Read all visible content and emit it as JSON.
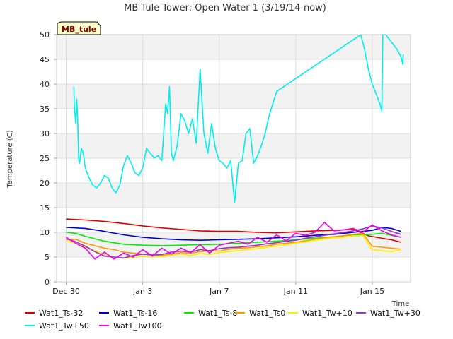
{
  "chart_data": {
    "type": "line",
    "title": "MB Tule Tower: Open Water 1 (3/19/14-now)",
    "xlabel": "Time",
    "ylabel": "Temperature (C)",
    "badge": "MB_tule",
    "ylim": [
      0,
      50
    ],
    "yticks": [
      0,
      5,
      10,
      15,
      20,
      25,
      30,
      35,
      40,
      45,
      50
    ],
    "xlim": [
      -0.5,
      18
    ],
    "xticks": [
      {
        "value": 0,
        "label": "Dec 30"
      },
      {
        "value": 4,
        "label": "Jan 3"
      },
      {
        "value": 8,
        "label": "Jan 7"
      },
      {
        "value": 12,
        "label": "Jan 11"
      },
      {
        "value": 16,
        "label": "Jan 15"
      }
    ],
    "grid": true,
    "legend_position": "bottom",
    "series": [
      {
        "name": "Wat1_Ts-32",
        "color": "#dd0000",
        "x": [
          0.0,
          1.0,
          2.0,
          3.0,
          4.0,
          5.0,
          6.0,
          7.0,
          8.0,
          9.0,
          10.0,
          11.0,
          12.0,
          13.0,
          14.0,
          15.0,
          15.8,
          16.5,
          17.0,
          17.5
        ],
        "values": [
          12.7,
          12.5,
          12.2,
          11.8,
          11.3,
          10.9,
          10.6,
          10.3,
          10.2,
          10.2,
          10.0,
          9.9,
          10.1,
          10.3,
          10.4,
          10.6,
          9.3,
          8.8,
          8.5,
          8.0
        ]
      },
      {
        "name": "Wat1_Ts-16",
        "color": "#0000cc",
        "x": [
          0.0,
          1.0,
          2.0,
          3.0,
          4.0,
          5.0,
          6.0,
          7.0,
          8.0,
          9.0,
          10.0,
          11.0,
          12.0,
          13.0,
          14.0,
          15.0,
          16.0,
          16.5,
          17.0,
          17.5
        ],
        "values": [
          11.0,
          10.8,
          10.2,
          9.5,
          9.0,
          8.7,
          8.5,
          8.4,
          8.5,
          8.6,
          8.7,
          8.9,
          9.1,
          9.4,
          9.6,
          10.0,
          10.4,
          11.0,
          10.8,
          10.2
        ]
      },
      {
        "name": "Wat1_Ts-8",
        "color": "#00ee00",
        "x": [
          0.0,
          0.5,
          1.0,
          2.0,
          3.0,
          4.0,
          5.0,
          6.0,
          7.0,
          8.0,
          9.0,
          10.0,
          11.0,
          12.0,
          13.0,
          14.0,
          15.0,
          16.0,
          16.5,
          17.0,
          17.5
        ],
        "values": [
          10.0,
          9.8,
          9.2,
          8.2,
          7.6,
          7.4,
          7.3,
          7.4,
          7.5,
          7.6,
          7.8,
          8.0,
          8.2,
          8.5,
          8.8,
          9.1,
          9.5,
          9.6,
          9.8,
          9.4,
          9.0
        ]
      },
      {
        "name": "Wat1_Ts0",
        "color": "#ff9900",
        "x": [
          0.0,
          0.5,
          1.0,
          1.5,
          2.0,
          2.5,
          3.0,
          3.5,
          4.0,
          4.5,
          5.0,
          5.5,
          6.0,
          6.5,
          7.0,
          7.5,
          8.0,
          8.5,
          9.0,
          9.5,
          10.0,
          10.5,
          11.0,
          11.5,
          12.0,
          12.5,
          13.0,
          13.5,
          14.0,
          14.5,
          15.0,
          15.5,
          16.0,
          16.5,
          17.0,
          17.5
        ],
        "values": [
          8.5,
          8.6,
          7.8,
          7.3,
          6.8,
          6.5,
          6.0,
          5.8,
          5.6,
          5.5,
          5.3,
          5.6,
          5.9,
          5.8,
          6.1,
          6.3,
          6.2,
          6.6,
          6.8,
          6.9,
          7.1,
          7.3,
          7.6,
          7.8,
          8.0,
          8.3,
          8.6,
          8.9,
          9.1,
          9.3,
          9.6,
          9.8,
          7.2,
          7.0,
          6.8,
          6.6
        ]
      },
      {
        "name": "Wat1_Tw+10",
        "color": "#ffee00",
        "x": [
          0.0,
          0.5,
          1.0,
          1.5,
          2.0,
          2.5,
          3.0,
          3.5,
          4.0,
          4.5,
          5.0,
          5.5,
          6.0,
          6.5,
          7.0,
          7.5,
          8.0,
          8.5,
          9.0,
          9.5,
          10.0,
          10.5,
          11.0,
          11.5,
          12.0,
          12.5,
          13.0,
          13.5,
          14.0,
          14.5,
          15.0,
          15.5,
          16.0,
          16.5,
          17.0,
          17.5
        ],
        "values": [
          8.2,
          7.9,
          7.0,
          6.3,
          5.6,
          5.0,
          4.8,
          4.9,
          5.2,
          5.0,
          5.1,
          5.4,
          5.6,
          5.3,
          5.7,
          5.5,
          5.9,
          6.1,
          6.3,
          6.5,
          6.7,
          7.0,
          7.2,
          7.5,
          7.8,
          8.1,
          8.4,
          8.7,
          8.9,
          9.0,
          9.2,
          9.4,
          6.5,
          6.3,
          6.1,
          6.5
        ]
      },
      {
        "name": "Wat1_Tw+30",
        "color": "#9933cc",
        "x": [
          0.0,
          0.5,
          1.0,
          1.5,
          2.0,
          2.5,
          3.0,
          3.5,
          4.0,
          4.5,
          5.0,
          5.5,
          6.0,
          6.5,
          7.0,
          7.5,
          8.0,
          8.5,
          9.0,
          9.5,
          10.0,
          10.5,
          11.0,
          11.5,
          12.0,
          12.5,
          13.0,
          13.5,
          14.0,
          14.5,
          15.0,
          15.5,
          16.0,
          16.5,
          17.0,
          17.5
        ],
        "values": [
          8.7,
          8.1,
          7.2,
          6.1,
          5.2,
          5.0,
          4.8,
          5.3,
          5.6,
          5.4,
          5.5,
          6.0,
          6.2,
          6.0,
          6.5,
          6.3,
          6.7,
          6.9,
          7.0,
          7.2,
          7.4,
          7.7,
          7.9,
          8.2,
          8.4,
          8.8,
          9.1,
          9.4,
          9.7,
          10.0,
          10.3,
          10.7,
          11.3,
          10.9,
          10.2,
          9.6
        ]
      },
      {
        "name": "Wat1_Tw+50",
        "color": "#00eeee",
        "x": [
          0.4,
          0.42,
          0.5,
          0.55,
          0.6,
          0.65,
          0.7,
          0.8,
          0.9,
          1.0,
          1.1,
          1.2,
          1.4,
          1.6,
          1.8,
          2.0,
          2.2,
          2.4,
          2.6,
          2.8,
          3.0,
          3.2,
          3.4,
          3.6,
          3.8,
          4.0,
          4.2,
          4.4,
          4.6,
          4.8,
          5.0,
          5.2,
          5.3,
          5.4,
          5.5,
          5.6,
          5.8,
          6.0,
          6.2,
          6.4,
          6.6,
          6.8,
          7.0,
          7.2,
          7.4,
          7.6,
          7.8,
          8.0,
          8.2,
          8.4,
          8.6,
          8.8,
          9.0,
          9.2,
          9.4,
          9.6,
          9.8,
          10.0,
          10.2,
          10.4,
          10.6,
          10.8,
          11.0,
          15.4,
          15.6,
          15.8,
          16.0,
          16.2,
          16.4,
          16.5,
          16.55,
          16.7,
          16.9,
          17.1,
          17.3,
          17.5,
          17.6,
          17.62
        ],
        "values": [
          39.5,
          36.0,
          32.0,
          37.0,
          33.0,
          25.0,
          24.0,
          27.0,
          26.0,
          23.0,
          22.0,
          21.0,
          19.5,
          19.0,
          20.0,
          21.5,
          21.0,
          19.0,
          18.0,
          19.5,
          23.5,
          25.5,
          24.0,
          22.0,
          21.5,
          23.0,
          27.0,
          26.0,
          25.0,
          25.5,
          24.5,
          36.0,
          34.0,
          39.5,
          26.0,
          24.5,
          27.5,
          34.0,
          32.5,
          30.0,
          33.0,
          28.0,
          43.0,
          30.0,
          26.0,
          32.0,
          27.0,
          24.5,
          24.0,
          23.0,
          24.5,
          16.0,
          24.0,
          24.5,
          30.0,
          31.0,
          24.0,
          25.5,
          27.5,
          30.0,
          33.5,
          36.0,
          38.5,
          50.0,
          47.0,
          43.0,
          40.0,
          38.0,
          36.0,
          34.5,
          50.0,
          50.0,
          49.0,
          48.0,
          47.0,
          45.5,
          44.0,
          46.0
        ]
      },
      {
        "name": "Wat1_Tw100",
        "color": "#ee00ee",
        "x": [
          0.0,
          0.5,
          1.0,
          1.5,
          2.0,
          2.5,
          3.0,
          3.5,
          4.0,
          4.5,
          5.0,
          5.5,
          6.0,
          6.5,
          7.0,
          7.5,
          8.0,
          8.5,
          9.0,
          9.5,
          10.0,
          10.5,
          11.0,
          11.5,
          12.0,
          12.5,
          13.0,
          13.5,
          14.0,
          14.5,
          15.0,
          15.5,
          16.0,
          16.5,
          17.0,
          17.5
        ],
        "values": [
          9.0,
          7.8,
          6.8,
          4.6,
          6.0,
          4.6,
          5.8,
          5.0,
          6.5,
          5.2,
          6.8,
          5.6,
          6.8,
          5.9,
          7.5,
          5.8,
          7.4,
          7.8,
          8.2,
          7.6,
          9.0,
          8.0,
          9.5,
          8.3,
          9.8,
          9.4,
          10.0,
          12.0,
          10.3,
          10.5,
          10.8,
          10.0,
          11.5,
          10.3,
          9.5,
          9.0
        ]
      }
    ]
  }
}
